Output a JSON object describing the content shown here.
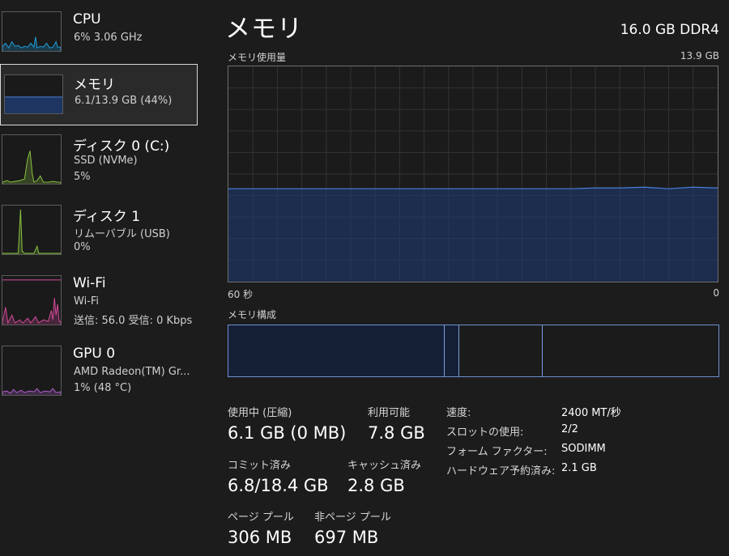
{
  "sidebar": {
    "items": [
      {
        "id": "cpu",
        "title": "CPU",
        "line1": "6% 3.06 GHz",
        "line2": ""
      },
      {
        "id": "memory",
        "title": "メモリ",
        "line1": "6.1/13.9 GB (44%)",
        "line2": ""
      },
      {
        "id": "disk0",
        "title": "ディスク 0 (C:)",
        "line1": "SSD (NVMe)",
        "line2": "5%"
      },
      {
        "id": "disk1",
        "title": "ディスク 1",
        "line1": "リムーバブル (USB)",
        "line2": "0%"
      },
      {
        "id": "wifi",
        "title": "Wi-Fi",
        "line1": "Wi-Fi",
        "line2": "送信: 56.0  受信: 0 Kbps"
      },
      {
        "id": "gpu0",
        "title": "GPU 0",
        "line1": "AMD Radeon(TM) Gr...",
        "line2": "1% (48 °C)"
      }
    ]
  },
  "main": {
    "title": "メモリ",
    "spec": "16.0 GB DDR4",
    "usage_label": "メモリ使用量",
    "usage_max": "13.9 GB",
    "time_left": "60 秒",
    "time_right": "0",
    "composition_label": "メモリ構成"
  },
  "chart_data": {
    "type": "area",
    "title": "メモリ使用量",
    "x_range": [
      60,
      0
    ],
    "ylim": [
      0,
      13.9
    ],
    "y_unit": "GB",
    "grid": true,
    "series": [
      {
        "values": [
          6.0,
          6.0,
          6.0,
          6.0,
          6.0,
          6.0,
          6.0,
          6.0,
          6.0,
          6.0,
          6.0,
          6.0,
          6.0,
          6.0,
          6.0,
          6.05,
          6.05,
          6.1,
          6.0,
          6.1,
          6.05
        ]
      }
    ]
  },
  "composition": {
    "in_use_fraction": 0.44,
    "modified_fraction": 0.03,
    "standby_fraction": 0.17
  },
  "stats": {
    "in_use_label": "使用中 (圧縮)",
    "in_use_value": "6.1 GB (0 MB)",
    "available_label": "利用可能",
    "available_value": "7.8 GB",
    "committed_label": "コミット済み",
    "committed_value": "6.8/18.4 GB",
    "cached_label": "キャッシュ済み",
    "cached_value": "2.8 GB",
    "paged_label": "ページ プール",
    "paged_value": "306 MB",
    "nonpaged_label": "非ページ プール",
    "nonpaged_value": "697 MB"
  },
  "details": [
    {
      "label": "速度:",
      "value": "2400 MT/秒"
    },
    {
      "label": "スロットの使用:",
      "value": "2/2"
    },
    {
      "label": "フォーム ファクター:",
      "value": "SODIMM"
    },
    {
      "label": "ハードウェア予約済み:",
      "value": "2.1 GB"
    }
  ],
  "colors": {
    "cpu": "#1f9fde",
    "memory": "#4a7fd8",
    "disk": "#8bc540",
    "wifi": "#d44a9a",
    "gpu": "#b15fd0"
  },
  "icons": {
    "cpu": "cpu-sparkline",
    "memory": "memory-sparkline",
    "disk0": "disk0-sparkline",
    "disk1": "disk1-sparkline",
    "wifi": "wifi-sparkline",
    "gpu0": "gpu-sparkline"
  }
}
